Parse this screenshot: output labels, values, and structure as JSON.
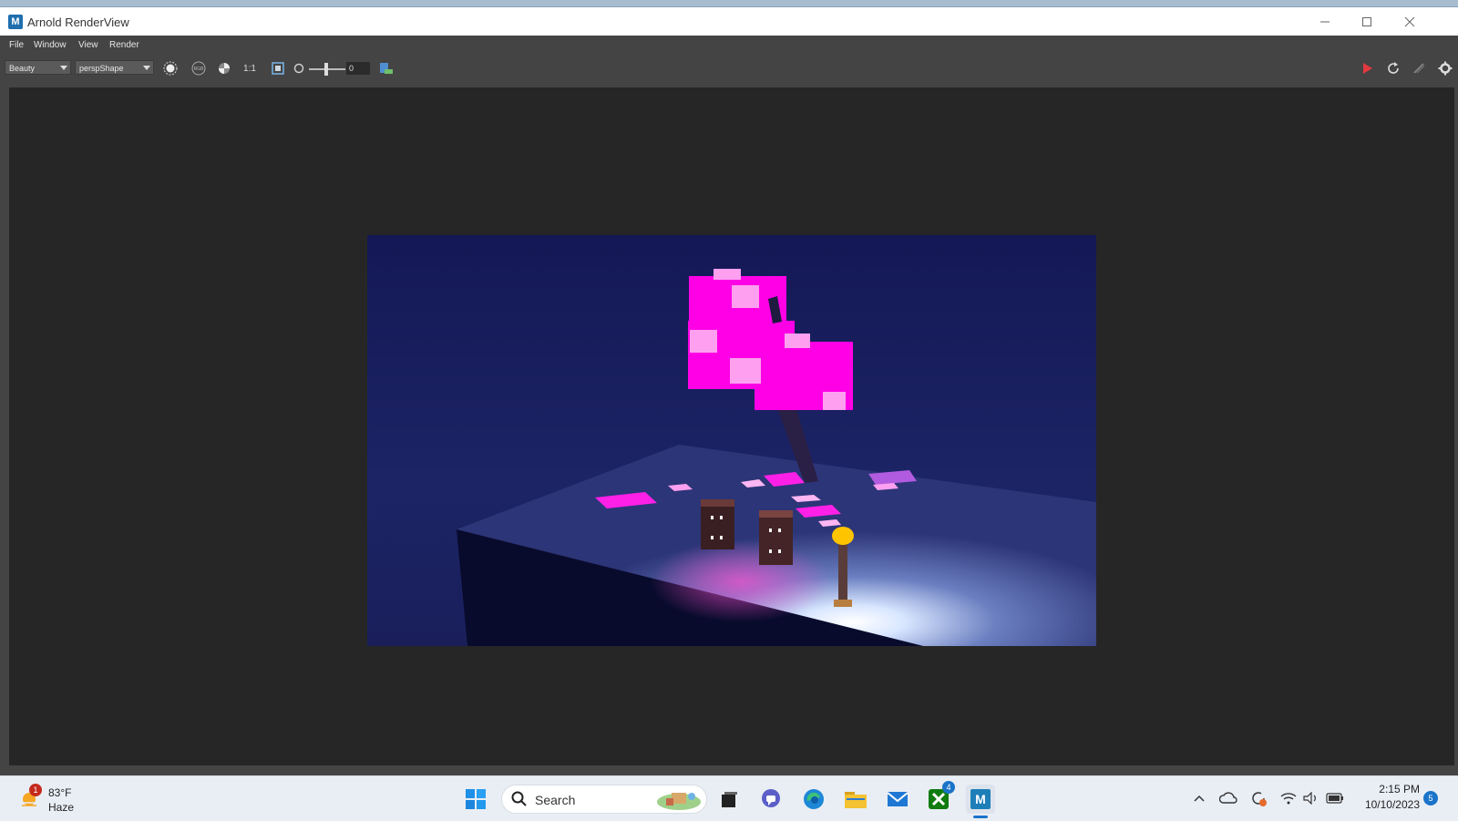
{
  "window": {
    "title": "Arnold RenderView",
    "app_icon": "M",
    "controls": [
      "minimize-icon",
      "maximize-icon",
      "close-icon"
    ]
  },
  "menubar": {
    "items": [
      "File",
      "Window",
      "View",
      "Render"
    ]
  },
  "toolbar": {
    "aov_select": "Beauty",
    "camera_select": "perspShape",
    "ratio_label": "1:1",
    "exposure_value": "0",
    "icons": [
      "display-all-icon",
      "rgb-channel-icon",
      "color-correct-icon",
      "one-to-one-icon",
      "frame-icon",
      "exposure-icon",
      "snapshot-icon",
      "render-play-icon",
      "refresh-icon",
      "pause-icon",
      "settings-gear-icon"
    ],
    "colors": {
      "render_play": "#e0393e"
    }
  },
  "taskbar": {
    "weather": {
      "temp": "83°F",
      "condition": "Haze",
      "badge": "1"
    },
    "search_label": "Search",
    "xbox_badge": "4",
    "clock": {
      "time": "2:15 PM",
      "date": "10/10/2023"
    },
    "notifications": "5"
  }
}
